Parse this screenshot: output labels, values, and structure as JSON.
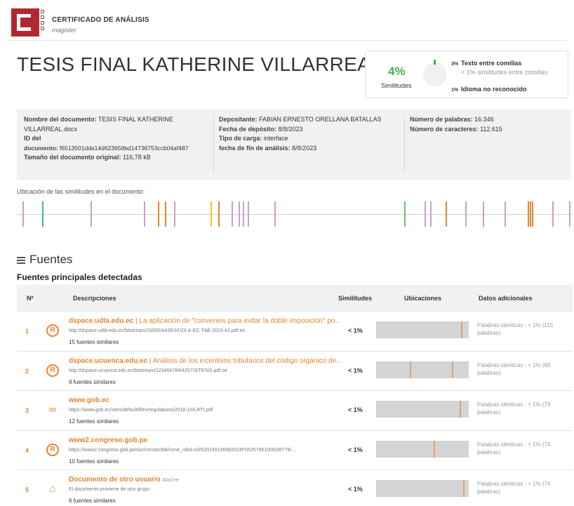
{
  "header": {
    "brand_title": "CERTIFICADO DE ANÁLISIS",
    "brand_sub": "magister",
    "logo_color": "#b3282f"
  },
  "document_title": "TESIS FINAL KATHERINE VILLARREAL",
  "similarity": {
    "percent": "4%",
    "label": "Similitudes",
    "rows": [
      {
        "pct": "3%",
        "title": "Texto entre comillas",
        "sub": "< 1% similitudes entre comillas"
      },
      {
        "pct": "1%",
        "title": "Idioma no reconocido"
      }
    ],
    "accent": "#4caf50"
  },
  "info": {
    "col1": {
      "name_label": "Nombre del documento:",
      "name_value_line1": "TESIS FINAL KATHERINE",
      "name_value_line2": "VILLARREAL.docx",
      "id_label_line1": "ID del",
      "id_label_line2": "documento:",
      "id_value": "f6513501dda14d623658bd14736753ccb04af487",
      "size_label": "Tamaño del documento original:",
      "size_value": "116,78 kB"
    },
    "col2": {
      "dep_label": "Depositante:",
      "dep_value": "FABIAN ERNESTO ORELLANA BATALLAS",
      "date_label": "Fecha de depósito:",
      "date_value": "8/8/2023",
      "type_label": "Tipo de carga:",
      "type_value": "interface",
      "end_label": "fecha de fin de análisis:",
      "end_value": "8/8/2023"
    },
    "col3": {
      "words_label": "Número de palabras:",
      "words_value": "16.346",
      "chars_label": "Número de caracteres:",
      "chars_value": "112.615"
    }
  },
  "locations": {
    "label": "Ubicación de las similitudes en el documento:",
    "marks": [
      {
        "pos": 0.01,
        "color": "#c9a0c9"
      },
      {
        "pos": 0.046,
        "color": "#4bb3a0"
      },
      {
        "pos": 0.133,
        "color": "#c9a0c9"
      },
      {
        "pos": 0.228,
        "color": "#c9a0c9"
      },
      {
        "pos": 0.254,
        "color": "#e8842c"
      },
      {
        "pos": 0.266,
        "color": "#e8842c"
      },
      {
        "pos": 0.283,
        "color": "#c9a0c9"
      },
      {
        "pos": 0.348,
        "color": "#f2c230"
      },
      {
        "pos": 0.362,
        "color": "#e8842c"
      },
      {
        "pos": 0.386,
        "color": "#c9a0c9"
      },
      {
        "pos": 0.399,
        "color": "#c9a0c9"
      },
      {
        "pos": 0.407,
        "color": "#c9a0c9"
      },
      {
        "pos": 0.416,
        "color": "#c9a0c9"
      },
      {
        "pos": 0.463,
        "color": "#c9a0c9"
      },
      {
        "pos": 0.697,
        "color": "#6bc06b"
      },
      {
        "pos": 0.733,
        "color": "#c9a0c9"
      },
      {
        "pos": 0.744,
        "color": "#c9a0c9"
      },
      {
        "pos": 0.772,
        "color": "#e8842c"
      },
      {
        "pos": 0.807,
        "color": "#c9a0c9"
      },
      {
        "pos": 0.838,
        "color": "#c9a0c9"
      },
      {
        "pos": 0.877,
        "color": "#c9a0c9"
      },
      {
        "pos": 0.919,
        "color": "#e8842c"
      },
      {
        "pos": 0.923,
        "color": "#e8842c"
      },
      {
        "pos": 0.927,
        "color": "#e8842c"
      },
      {
        "pos": 0.963,
        "color": "#c9a0c9"
      },
      {
        "pos": 0.994,
        "color": "#c9a0c9"
      }
    ]
  },
  "sources": {
    "heading": "Fuentes",
    "subheading": "Fuentes principales detectadas",
    "columns": {
      "n": "Nº",
      "desc": "Descripciones",
      "sim": "Similitudes",
      "loc": "Ubicaciones",
      "extra": "Datos adicionales"
    },
    "rows": [
      {
        "n": "1",
        "icon": "repository-icon",
        "domain": "dspace.udla.edu.ec",
        "desc": " | La aplicación de \"convenios para evitar la doble imposición\" po...",
        "url": "http://dspace.udla.edu.ec/bitstream/33000/4439/3/UDLA-EC-TAB-2015-42.pdf.txt",
        "count": "15 fuentes similares",
        "sim": "< 1%",
        "marks": [
          0.92
        ],
        "extra": "Palabras idénticas : < 1% (115 palabras)"
      },
      {
        "n": "2",
        "icon": "repository-icon",
        "domain": "dspace.ucuenca.edu.ec",
        "desc": " | Análisis de los incentivos tributarios del código orgánico de...",
        "url": "http://dspace.ucuenca.edu.ec/bitstream/123456789/4257/3/TESIS.pdf.txt",
        "count": "9 fuentes similares",
        "sim": "< 1%",
        "marks": [
          0.36,
          0.82
        ],
        "extra": "Palabras idénticas : < 1% (69 palabras)"
      },
      {
        "n": "3",
        "icon": "link-icon",
        "domain": "www.gob.ec",
        "desc": "",
        "url": "https://www.gob.ec/sites/default/files/regulations/2018-10/LRTI.pdf",
        "count": "12 fuentes similares",
        "sim": "< 1%",
        "marks": [
          0.9
        ],
        "extra": "Palabras idénticas : < 1% (79 palabras)"
      },
      {
        "n": "4",
        "icon": "repository-icon",
        "domain": "www2.congreso.gob.pe",
        "desc": "",
        "url": "https://www2.congreso.gob.pe/sicr/cendocbib/con4_uibd.nsf/620249145582024F05257851005DB778/...",
        "count": "10 fuentes similares",
        "sim": "< 1%",
        "marks": [
          0.62
        ],
        "extra": "Palabras idénticas : < 1% (74 palabras)"
      },
      {
        "n": "5",
        "icon": "institution-icon",
        "domain": "Documento de otro usuario",
        "tag": "#0a1ee",
        "desc": "",
        "url": "El documento proviene de otro grupo",
        "count": "6 fuentes similares",
        "sim": "< 1%",
        "marks": [
          0.94
        ],
        "extra": "Palabras idénticas : < 1% (74 palabras)"
      }
    ]
  }
}
